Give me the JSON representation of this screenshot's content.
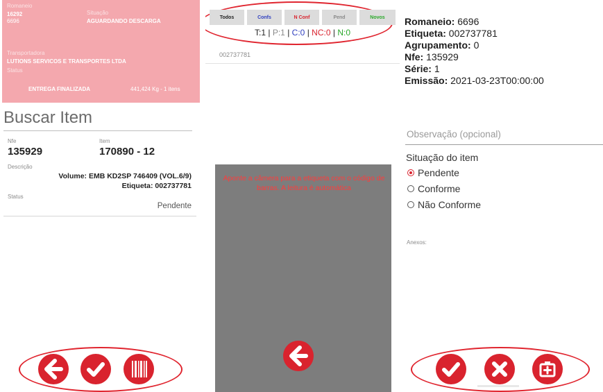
{
  "screen1": {
    "header": {
      "romaneio_label": "Romaneio",
      "romaneio_value": "16292",
      "romaneio_sub": "6696",
      "situacao_label": "Situação",
      "situacao_value": "AGUARDANDO DESCARGA",
      "transportadora_label": "Transportadora",
      "transportadora_value": "LUTIONS SERVICOS E TRANSPORTES LTDA",
      "status_label": "Status",
      "status_value": "ENTREGA FINALIZADA",
      "weight": "441,424 Kg - 1 itens",
      "bg_color": "#f4a8ae"
    },
    "search_title": "Buscar Item",
    "nfe_label": "Nfe",
    "nfe_value": "135929",
    "item_label": "Item",
    "item_value": "170890 - 12",
    "descricao_label": "Descrição",
    "descricao_value": "Volume: EMB KD2SP 746409 (VOL.6/9)",
    "etiqueta_value": "Etiqueta: 002737781",
    "status_label": "Status",
    "status_value": "Pendente",
    "buttons": [
      "back-icon",
      "check-icon",
      "barcode-icon"
    ],
    "accent": "#d9232e"
  },
  "screen2": {
    "filters": [
      "Todos",
      "Confs",
      "N Conf",
      "Pend",
      "Novos"
    ],
    "filter_colors": [
      "#222222",
      "#2f3fbf",
      "#d9232e",
      "#8a8a8a",
      "#2aa82a"
    ],
    "counts": {
      "t": "T:1",
      "p": "P:1",
      "c": "C:0",
      "nc": "NC:0",
      "n": "N:0",
      "sep": "|"
    },
    "code": "002737781",
    "camera_message": "Aponte a câmera para a etiqueta com o código de barras. A leitura é automática",
    "buttons": [
      "back-icon"
    ]
  },
  "screen3": {
    "romaneio_label": "Romaneio:",
    "romaneio_value": "6696",
    "etiqueta_label": "Etiqueta:",
    "etiqueta_value": "002737781",
    "agrupamento_label": "Agrupamento:",
    "agrupamento_value": "0",
    "nfe_label": "Nfe:",
    "nfe_value": "135929",
    "serie_label": "Série:",
    "serie_value": "1",
    "emissao_label": "Emissão:",
    "emissao_value": "2021-03-23T00:00:00",
    "observacao_placeholder": "Observação (opcional)",
    "situacao_title": "Situação do item",
    "options": [
      "Pendente",
      "Conforme",
      "Não Conforme"
    ],
    "selected_option": "Pendente",
    "anexos_label": "Anexos:",
    "buttons": [
      "check-icon",
      "close-icon",
      "add-photo-icon"
    ]
  }
}
